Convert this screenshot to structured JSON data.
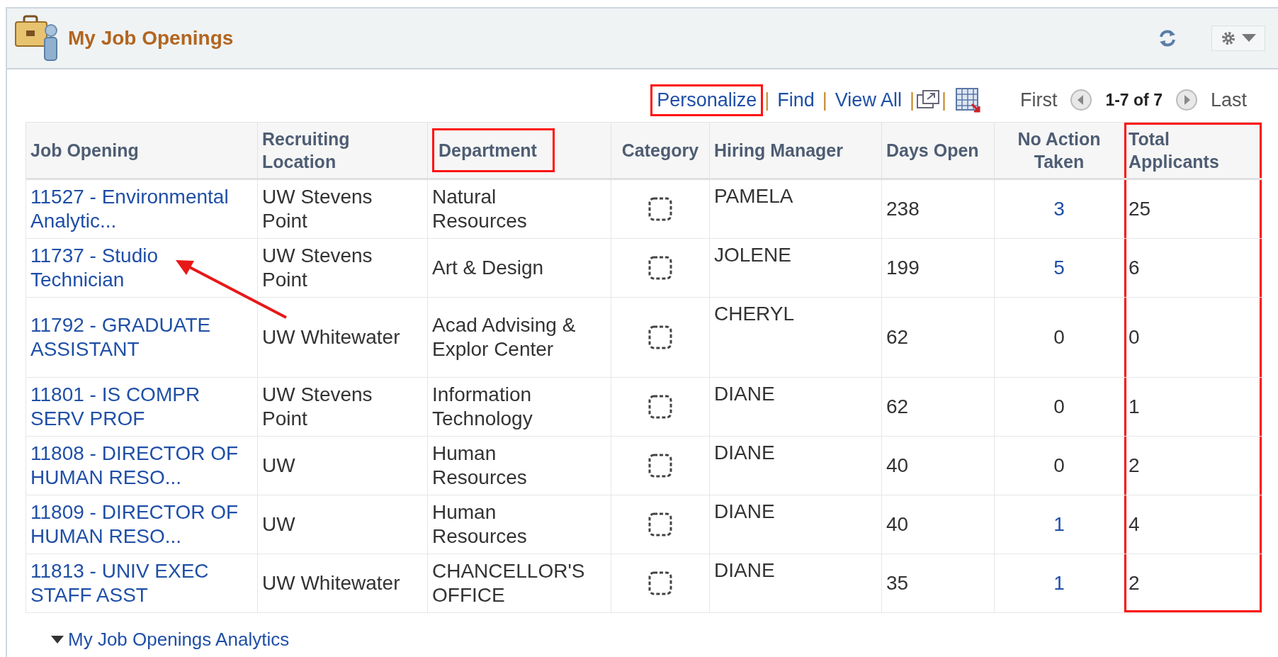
{
  "panel": {
    "title": "My Job Openings"
  },
  "toolbar": {
    "items": [
      {
        "kind": "link",
        "label": "Personalize",
        "highlighted": true
      },
      {
        "kind": "separator",
        "label": "|"
      },
      {
        "kind": "link",
        "label": "Find",
        "highlighted": false
      },
      {
        "kind": "separator",
        "label": "|"
      },
      {
        "kind": "link",
        "label": "View All",
        "highlighted": false
      },
      {
        "kind": "separator",
        "label": "|"
      },
      {
        "kind": "new_window"
      },
      {
        "kind": "separator",
        "label": "|"
      },
      {
        "kind": "spreadsheet"
      }
    ],
    "first": "First",
    "range": "1-7 of 7",
    "last": "Last"
  },
  "table": {
    "columns": [
      {
        "label": "Job Opening",
        "boxed": false,
        "outlined": false
      },
      {
        "label": "Recruiting Location",
        "boxed": false,
        "outlined": false
      },
      {
        "label": "Department",
        "boxed": true,
        "outlined": false
      },
      {
        "label": "Category",
        "boxed": false,
        "outlined": false
      },
      {
        "label": "Hiring Manager",
        "boxed": false,
        "outlined": false
      },
      {
        "label": "Days Open",
        "boxed": false,
        "outlined": false
      },
      {
        "label": "No Action Taken",
        "boxed": false,
        "outlined": false
      },
      {
        "label": "Total Applicants",
        "boxed": false,
        "outlined": true
      }
    ],
    "rows": [
      {
        "job_opening": "11527 - Environmental Analytic...",
        "location": "UW Stevens Point",
        "department": "Natural Resources",
        "hiring_manager": "PAMELA",
        "days_open": "238",
        "no_action": "3",
        "no_action_link": true,
        "total": "25"
      },
      {
        "job_opening": "11737 - Studio Technician",
        "location": "UW Stevens Point",
        "department": "Art & Design",
        "hiring_manager": "JOLENE",
        "days_open": "199",
        "no_action": "5",
        "no_action_link": true,
        "total": "6"
      },
      {
        "job_opening": "11792 - GRADUATE ASSISTANT",
        "location": "UW Whitewater",
        "department": "Acad Advising & Explor Center",
        "hiring_manager": "CHERYL",
        "days_open": "62",
        "no_action": "0",
        "no_action_link": false,
        "total": "0"
      },
      {
        "job_opening": "11801 - IS COMPR SERV PROF",
        "location": "UW Stevens Point",
        "department": "Information Technology",
        "hiring_manager": "DIANE",
        "days_open": "62",
        "no_action": "0",
        "no_action_link": false,
        "total": "1"
      },
      {
        "job_opening": "11808 - DIRECTOR OF HUMAN RESO...",
        "location": "UW",
        "department": "Human Resources",
        "hiring_manager": "DIANE",
        "days_open": "40",
        "no_action": "0",
        "no_action_link": false,
        "total": "2"
      },
      {
        "job_opening": "11809 - DIRECTOR OF HUMAN RESO...",
        "location": "UW",
        "department": "Human Resources",
        "hiring_manager": "DIANE",
        "days_open": "40",
        "no_action": "1",
        "no_action_link": true,
        "total": "4"
      },
      {
        "job_opening": "11813 - UNIV EXEC STAFF ASST",
        "location": "UW Whitewater",
        "department": "CHANCELLOR'S OFFICE",
        "hiring_manager": "DIANE",
        "days_open": "35",
        "no_action": "1",
        "no_action_link": true,
        "total": "2"
      }
    ]
  },
  "annotation_arrow": true,
  "analytics_link": {
    "label": "My Job Openings Analytics",
    "expanded": true
  }
}
